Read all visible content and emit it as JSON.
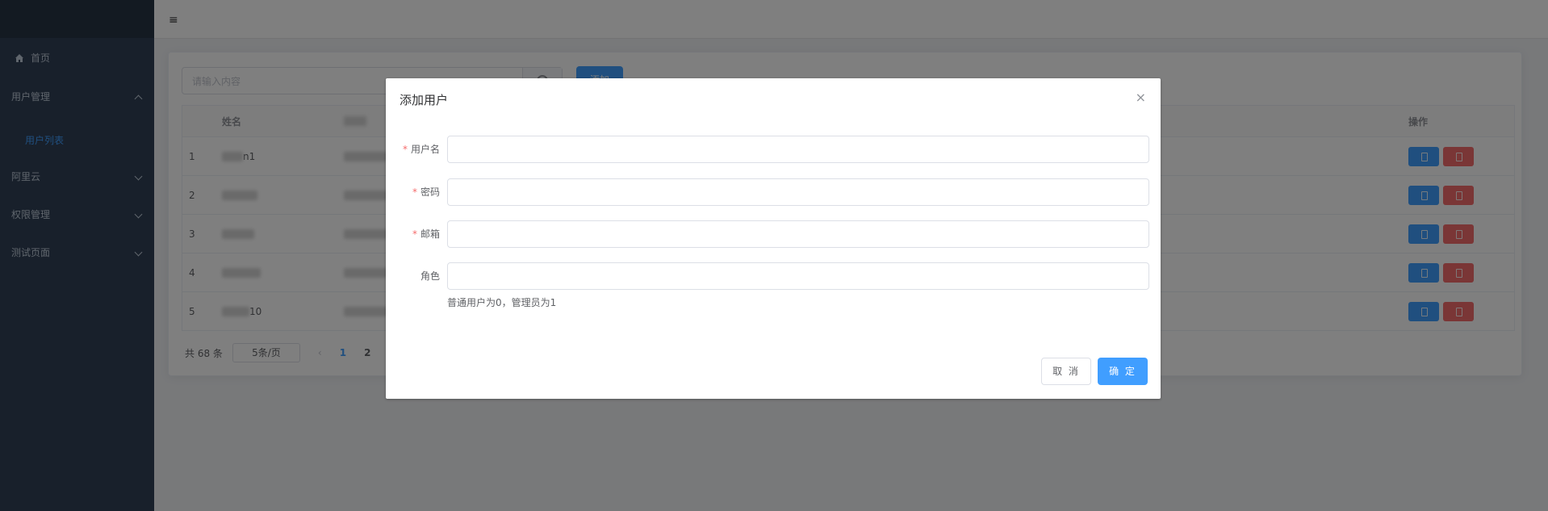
{
  "sidebar": {
    "items": [
      {
        "label": "首页",
        "icon": "home-icon"
      },
      {
        "label": "用户管理",
        "expanded": true
      },
      {
        "label": "用户列表",
        "active": true
      },
      {
        "label": "阿里云"
      },
      {
        "label": "权限管理"
      },
      {
        "label": "测试页面"
      }
    ]
  },
  "header": {
    "menu_icon": "≡"
  },
  "main": {
    "search_placeholder": "请输入内容",
    "add_label": "添加",
    "table": {
      "columns": [
        "姓名",
        "操作"
      ],
      "rows": [
        {
          "index": "1",
          "name_suffix": "n1"
        },
        {
          "index": "2",
          "name_suffix": ""
        },
        {
          "index": "3",
          "name_suffix": ""
        },
        {
          "index": "4",
          "name_suffix": ""
        },
        {
          "index": "5",
          "name_suffix": "10"
        }
      ]
    },
    "pagination": {
      "total_label": "共 68 条",
      "page_size": "5条/页",
      "pages": [
        "1",
        "2"
      ],
      "current_page": "1"
    }
  },
  "dialog": {
    "title": "添加用户",
    "fields": [
      {
        "label": "用户名",
        "required": true,
        "value": ""
      },
      {
        "label": "密码",
        "required": true,
        "value": ""
      },
      {
        "label": "邮箱",
        "required": true,
        "value": ""
      },
      {
        "label": "角色",
        "required": false,
        "value": ""
      }
    ],
    "role_hint": "普通用户为0，管理员为1",
    "cancel_label": "取 消",
    "confirm_label": "确 定"
  },
  "colors": {
    "primary": "#409eff",
    "danger": "#f56c6c",
    "sidebar_bg": "#304156"
  }
}
